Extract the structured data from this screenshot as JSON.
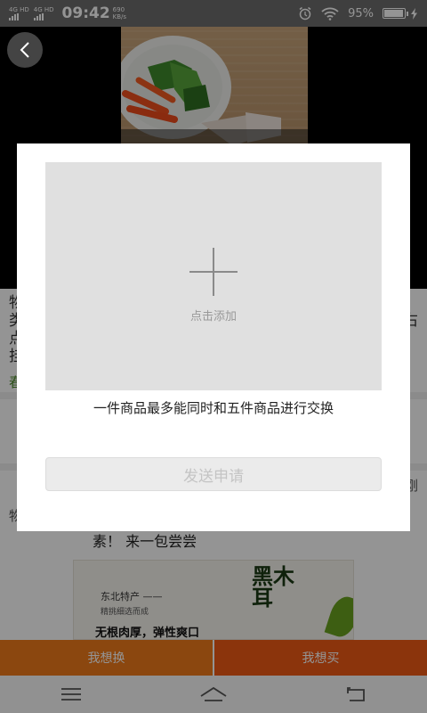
{
  "status_bar": {
    "sim1_label": "4G HD",
    "sim2_label": "4G HD",
    "time": "09:42",
    "net_speed_value": "690",
    "net_speed_unit": "KB/s",
    "battery_percent": "95%",
    "battery_level": 0.95,
    "icons": [
      "alarm-icon",
      "wifi-icon",
      "battery-icon",
      "charging-icon"
    ]
  },
  "media": {
    "back_icon": "chevron-left-icon"
  },
  "page": {
    "info_line1": "物",
    "info_line2": "类",
    "info_line2_right": "右",
    "info_line3": "点",
    "info_line4": "挂",
    "green_text": "春",
    "desc_label": "物",
    "desc_right": "刚",
    "desc_text": "素！ 来一包尝尝",
    "banner": {
      "subtitle": "东北特产 ——",
      "subtitle2": "精挑细选而成",
      "title": "黑木耳",
      "slogan": "无根肉厚，弹性爽口"
    }
  },
  "actions": {
    "swap_label": "我想换",
    "buy_label": "我想买"
  },
  "nav": {
    "icons": [
      "menu-icon",
      "home-icon",
      "back-icon"
    ]
  },
  "dialog": {
    "upload_hint": "点击添加",
    "limit_note": "一件商品最多能同时和五件商品进行交换",
    "send_label": "发送申请"
  },
  "colors": {
    "overlay": "#000000",
    "swap_button": "#f07a1a",
    "buy_button": "#ef5a16",
    "disabled_button": "#ebebeb"
  }
}
